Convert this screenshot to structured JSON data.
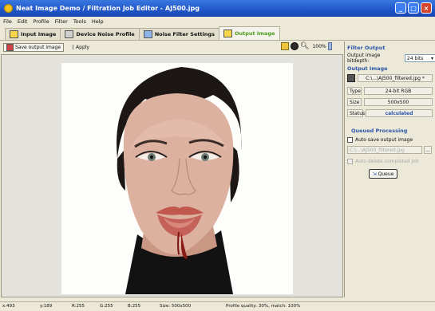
{
  "window": {
    "title": "Neat Image Demo / Filtration Job Editor - AJ500.jpg"
  },
  "menu": [
    "File",
    "Edit",
    "Profile",
    "Filter",
    "Tools",
    "Help"
  ],
  "tabs": [
    {
      "label": "Input Image",
      "active": false
    },
    {
      "label": "Device Noise Profile",
      "active": false
    },
    {
      "label": "Noise Filter Settings",
      "active": false
    },
    {
      "label": "Output Image",
      "active": true
    }
  ],
  "toolbar": {
    "save_label": "Save output image",
    "apply_label": "Apply",
    "zoom": "100%"
  },
  "panel": {
    "filter_output": {
      "title": "Filter Output",
      "bitdepth_label": "Output image bitdepth:",
      "bitdepth_value": "24 bits"
    },
    "output_image": {
      "title": "Output Image",
      "path": "C:\\...\\AJ500_filtered.jpg *",
      "type_label": "Type",
      "type_value": "24-bit RGB",
      "size_label": "Size",
      "size_value": "500x500",
      "status_label": "Status:",
      "status_value": "calculated"
    },
    "queued": {
      "title": "Queued Processing",
      "autosave_label": "Auto save output image",
      "autosave_path": "C:\\...\\AJ500_filtered.jpg",
      "autodelete_label": "Auto delete completed job",
      "queue_button": "Queue"
    }
  },
  "status": {
    "x": "x:493",
    "y": "y:189",
    "r": "R:255",
    "g": "G:255",
    "b": "B:255",
    "size": "Size: 500x500",
    "profile": "Profile quality: 30%, match: 100%"
  },
  "colors": {
    "accent_green": "#4c9a1c",
    "section_blue": "#2b55a8",
    "titlebar_blue": "#1f55c8"
  },
  "icons": [
    "app-icon",
    "input-image-icon",
    "device-noise-profile-icon",
    "noise-filter-icon",
    "output-image-icon",
    "save-icon",
    "apply-icon",
    "zoom-icon"
  ]
}
